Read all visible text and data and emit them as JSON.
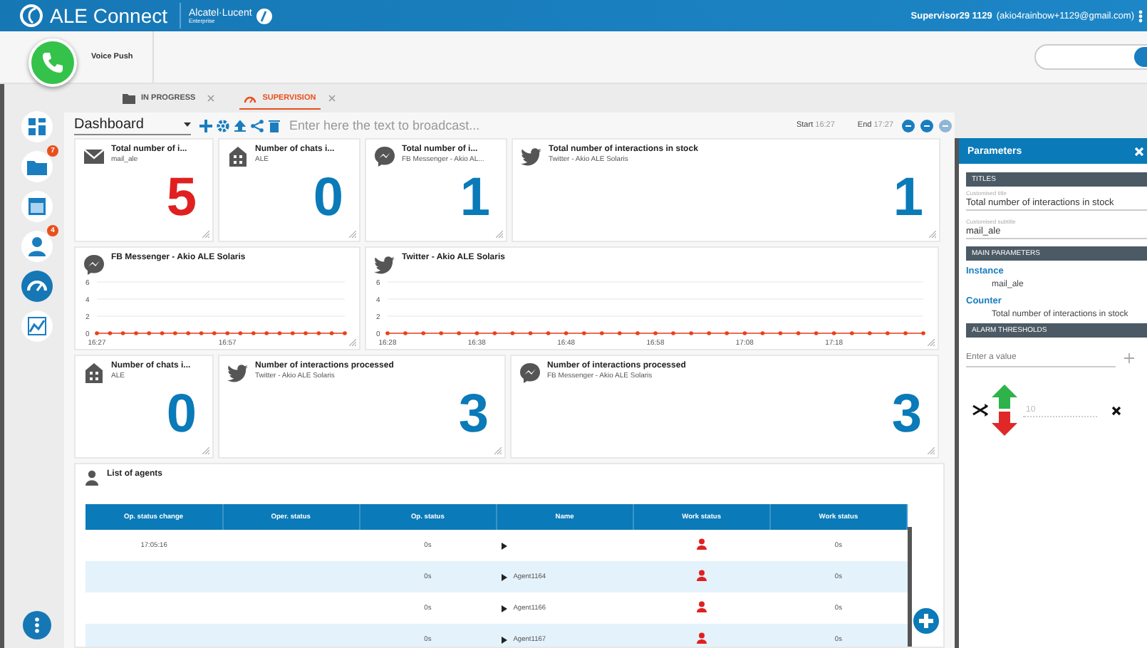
{
  "header": {
    "app_name": "ALE Connect",
    "brand": "Alcatel·Lucent",
    "brand_sub": "Enterprise",
    "user": "Supervisor29 1129",
    "email": "(akio4rainbow+1129@gmail.com)"
  },
  "call_bar": {
    "label": "Voice Push"
  },
  "sidebar": {
    "items": [
      {
        "selected": false
      },
      {
        "selected": false,
        "badge": "7"
      },
      {
        "selected": false
      },
      {
        "selected": false,
        "badge": "4"
      },
      {
        "selected": true
      },
      {
        "selected": false
      }
    ]
  },
  "tabs": [
    {
      "label": "IN PROGRESS",
      "selected": false
    },
    {
      "label": "SUPERVISION",
      "selected": true
    }
  ],
  "toolbar": {
    "dashboard": "Dashboard",
    "broadcast_placeholder": "Enter here the text to broadcast...",
    "start_label": "Start",
    "start": "16:27",
    "end_label": "End",
    "end": "17:27"
  },
  "widget_rows": [
    [
      {
        "kind": "counter",
        "title": "Total number of i...",
        "subtitle": "mail_ale",
        "value": "5",
        "alarm": true
      },
      {
        "kind": "counter",
        "title": "Number of chats i...",
        "subtitle": "ALE",
        "value": "0",
        "alarm": false
      },
      {
        "kind": "counter",
        "title": "Total number of i...",
        "subtitle": "FB Messenger - Akio AL...",
        "value": "1",
        "alarm": false
      },
      {
        "kind": "counter",
        "title": "Total number of interactions in stock",
        "subtitle": "Twitter - Akio ALE Solaris",
        "value": "1",
        "alarm": false
      }
    ],
    [
      {
        "kind": "chart",
        "title": "FB Messenger - Akio ALE Solaris",
        "chart_data": {
          "type": "line",
          "categories": [
            "16:27",
            null,
            null,
            null,
            null,
            null,
            null,
            null,
            null,
            null,
            "16:57",
            null,
            null,
            null,
            null,
            null,
            null,
            null,
            null,
            null
          ],
          "series": [
            {
              "color": "#e8401c",
              "values": [
                0,
                0,
                0,
                0,
                0,
                0,
                0,
                0,
                0,
                0,
                0,
                0,
                0,
                0,
                0,
                0,
                0,
                0,
                0,
                0
              ]
            }
          ],
          "ylim": [
            0,
            6
          ],
          "yticks": [
            0,
            2,
            4,
            6
          ]
        }
      },
      {
        "kind": "chart",
        "title": "Twitter - Akio ALE Solaris",
        "chart_data": {
          "type": "line",
          "categories": [
            "16:28",
            null,
            null,
            null,
            null,
            "16:38",
            null,
            null,
            null,
            null,
            "16:48",
            null,
            null,
            null,
            null,
            "16:58",
            null,
            null,
            null,
            null,
            "17:08",
            null,
            null,
            null,
            null,
            "17:18",
            null,
            null,
            null,
            null,
            null
          ],
          "series": [
            {
              "color": "#e8401c",
              "values": [
                0,
                0,
                0,
                0,
                0,
                0,
                0,
                0,
                0,
                0,
                0,
                0,
                0,
                0,
                0,
                0,
                0,
                0,
                0,
                0,
                0,
                0,
                0,
                0,
                0,
                0,
                0,
                0,
                0,
                0,
                0
              ]
            }
          ],
          "ylim": [
            0,
            6
          ],
          "yticks": [
            0,
            2,
            4,
            6
          ]
        }
      }
    ],
    [
      {
        "kind": "counter",
        "title": "Number of chats i...",
        "subtitle": "ALE",
        "value": "0",
        "alarm": false
      },
      {
        "kind": "counter",
        "title": "Number of interactions processed",
        "subtitle": "Twitter - Akio ALE Solaris",
        "value": "3",
        "alarm": false
      },
      {
        "kind": "counter",
        "title": "Number of interactions processed",
        "subtitle": "FB Messenger - Akio ALE Solaris",
        "value": "3",
        "alarm": false
      }
    ]
  ],
  "agents": {
    "title": "List of agents",
    "columns": [
      "Op. status change",
      "Oper. status",
      "Op. status",
      "Name",
      "Work status",
      "Work status"
    ],
    "rows": [
      {
        "time": "17:05:16",
        "oper_status": "",
        "op_status": "0s",
        "name": "",
        "color": "#e02020",
        "work_time": "0s"
      },
      {
        "time": "",
        "oper_status": "",
        "op_status": "0s",
        "name": "Agent1164",
        "color": "#e02020",
        "work_time": "0s"
      },
      {
        "time": "",
        "oper_status": "",
        "op_status": "0s",
        "name": "Agent1166",
        "color": "#e02020",
        "work_time": "0s"
      },
      {
        "time": "",
        "oper_status": "",
        "op_status": "0s",
        "name": "Agent1167",
        "color": "#e02020",
        "work_time": "0s"
      }
    ]
  },
  "parameters": {
    "title": "Parameters",
    "sections": [
      {
        "kind": "fields",
        "heading": "TITLES",
        "fields": [
          {
            "label": "Customised title",
            "value": "Total number of interactions in stock"
          },
          {
            "label": "Customised subtitle",
            "value": "mail_ale"
          }
        ]
      },
      {
        "kind": "info",
        "heading": "MAIN PARAMETERS",
        "items": [
          {
            "label": "Instance",
            "value": "mail_ale"
          },
          {
            "label": "Counter",
            "value": "Total number of interactions in stock"
          }
        ]
      },
      {
        "kind": "thresholds",
        "heading": "ALARM THRESHOLDS",
        "placeholder": "Enter a value",
        "thresholds": [
          {
            "placeholder": "10"
          }
        ]
      }
    ]
  }
}
